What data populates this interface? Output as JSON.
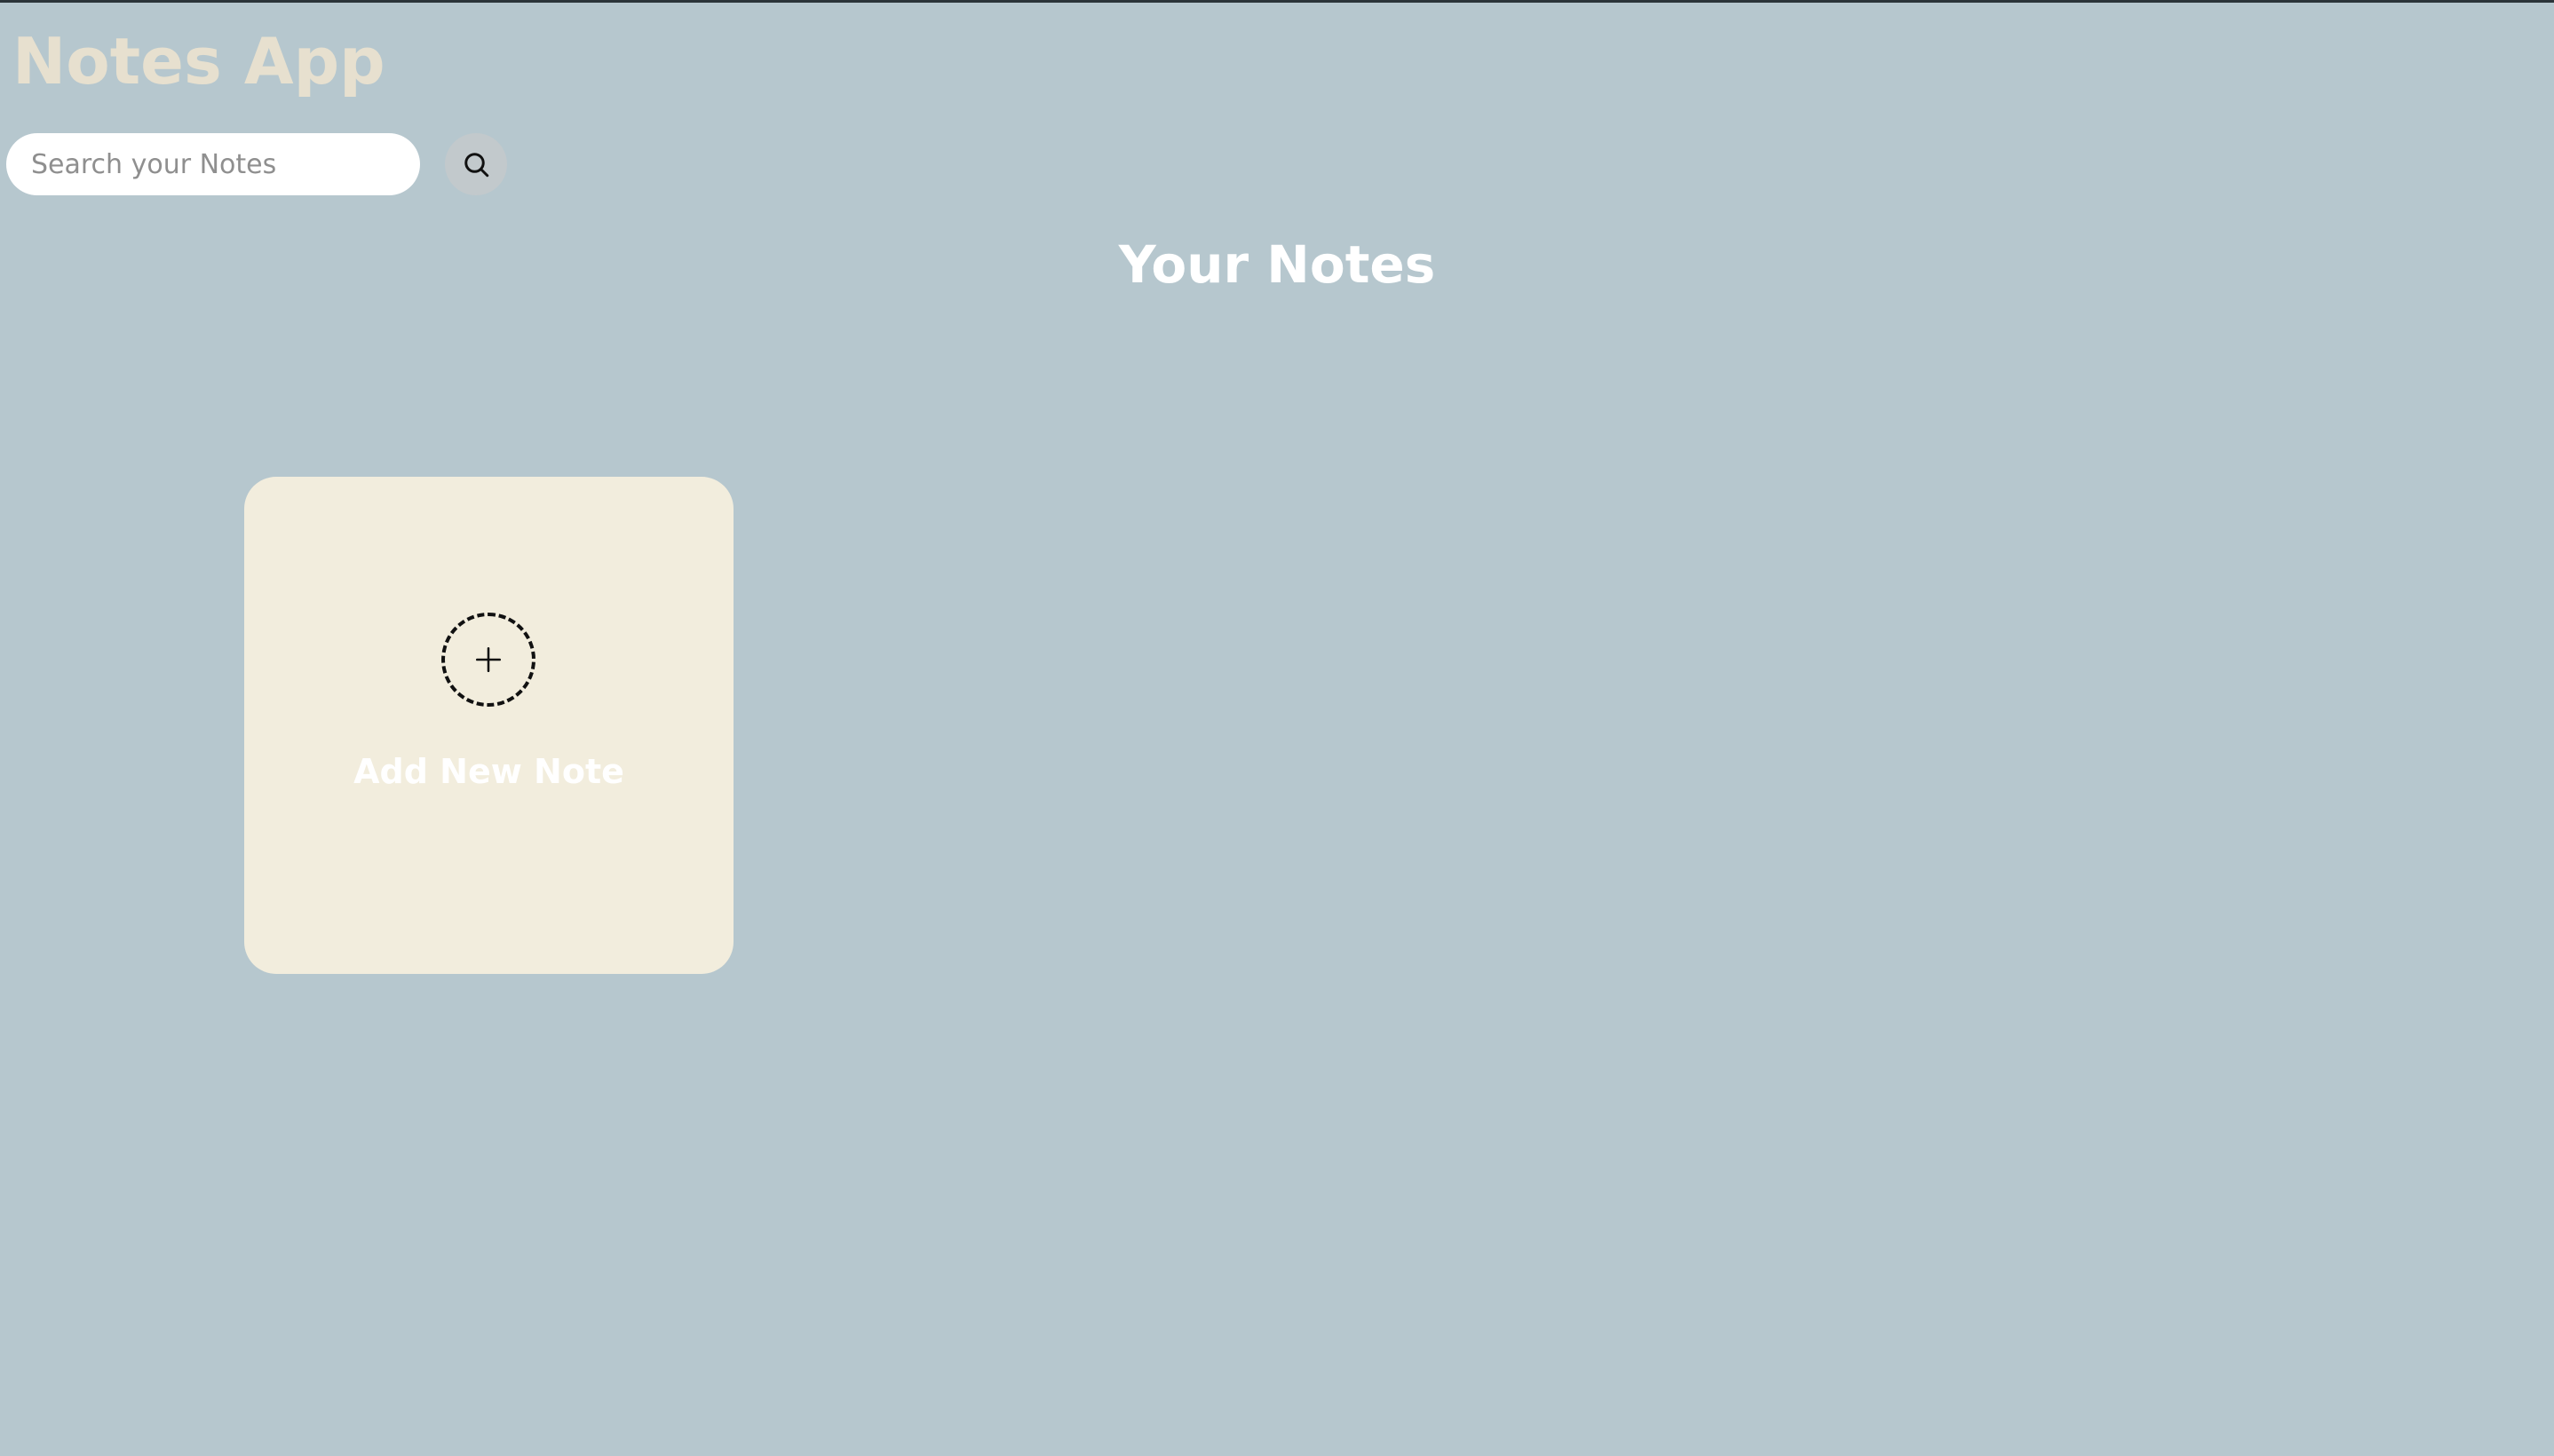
{
  "app": {
    "title": "Notes App"
  },
  "search": {
    "placeholder": "Search your Notes",
    "value": "",
    "button_icon": "search-icon"
  },
  "main": {
    "heading": "Your Notes",
    "add_note": {
      "label": "Add New Note",
      "icon": "plus-icon"
    }
  },
  "colors": {
    "background": "#b6c7ce",
    "title": "#e7e0cf",
    "card": "#f2eddd",
    "search_button": "#c2c9cc",
    "text_light": "#ffffff"
  }
}
